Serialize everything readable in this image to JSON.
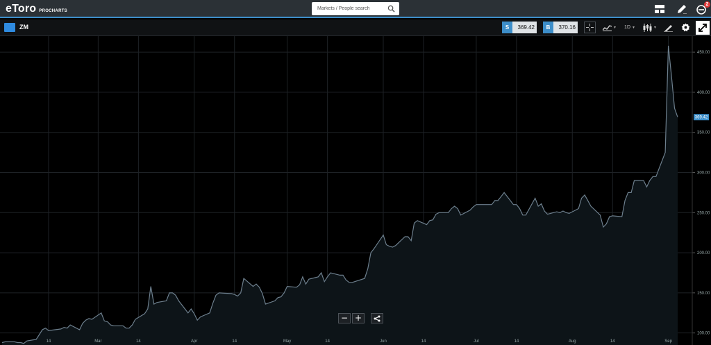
{
  "header": {
    "logo_text": "eToro",
    "logo_sub": "PROCHARTS",
    "search_placeholder": "Markets / People search",
    "notification_count": "2"
  },
  "toolbar": {
    "symbol": "ZM",
    "sell_label": "S",
    "sell_price": "369.42",
    "buy_label": "B",
    "buy_price": "370.16",
    "timeframe": "1D"
  },
  "colors": {
    "accent": "#3d8ec9",
    "line": "#6d7f8d",
    "area_fill": "#0d1418",
    "grid": "#1e2226"
  },
  "icons": [
    "search-icon",
    "layout-icon",
    "pencil-icon",
    "notification-icon",
    "crosshair-icon",
    "indicators-icon",
    "candlestick-icon",
    "draw-tools-icon",
    "gear-icon",
    "expand-icon",
    "share-icon"
  ],
  "chart_data": {
    "type": "area",
    "current_price_label": "369.42",
    "ylim": [
      85,
      470
    ],
    "y_ticks": [
      100,
      150,
      200,
      250,
      300,
      350,
      400,
      450
    ],
    "y_tick_labels": [
      "100.00",
      "150.00",
      "200.00",
      "250.00",
      "300.00",
      "350.00",
      "400.00",
      "450.00"
    ],
    "x_ticks": [
      {
        "date": "2020-02-14",
        "label": "14"
      },
      {
        "date": "2020-03-01",
        "label": "Mar"
      },
      {
        "date": "2020-03-14",
        "label": "14"
      },
      {
        "date": "2020-04-01",
        "label": "Apr"
      },
      {
        "date": "2020-04-14",
        "label": "14"
      },
      {
        "date": "2020-05-01",
        "label": "May"
      },
      {
        "date": "2020-05-14",
        "label": "14"
      },
      {
        "date": "2020-06-01",
        "label": "Jun"
      },
      {
        "date": "2020-06-14",
        "label": "14"
      },
      {
        "date": "2020-07-01",
        "label": "Jul"
      },
      {
        "date": "2020-07-14",
        "label": "14"
      },
      {
        "date": "2020-08-01",
        "label": "Aug"
      },
      {
        "date": "2020-08-14",
        "label": "14"
      },
      {
        "date": "2020-09-01",
        "label": "Sep"
      }
    ],
    "series": [
      {
        "x": [
          "2020-01-30",
          "2020-01-31",
          "2020-02-03",
          "2020-02-04",
          "2020-02-05",
          "2020-02-06",
          "2020-02-07",
          "2020-02-10",
          "2020-02-11",
          "2020-02-12",
          "2020-02-13",
          "2020-02-14",
          "2020-02-18",
          "2020-02-19",
          "2020-02-20",
          "2020-02-21",
          "2020-02-24",
          "2020-02-25",
          "2020-02-26",
          "2020-02-27",
          "2020-02-28",
          "2020-03-02",
          "2020-03-03",
          "2020-03-04",
          "2020-03-05",
          "2020-03-06",
          "2020-03-09",
          "2020-03-10",
          "2020-03-11",
          "2020-03-12",
          "2020-03-13",
          "2020-03-16",
          "2020-03-17",
          "2020-03-18",
          "2020-03-19",
          "2020-03-20",
          "2020-03-23",
          "2020-03-24",
          "2020-03-25",
          "2020-03-26",
          "2020-03-27",
          "2020-03-30",
          "2020-03-31",
          "2020-04-01",
          "2020-04-02",
          "2020-04-03",
          "2020-04-06",
          "2020-04-07",
          "2020-04-08",
          "2020-04-09",
          "2020-04-13",
          "2020-04-14",
          "2020-04-15",
          "2020-04-16",
          "2020-04-17",
          "2020-04-20",
          "2020-04-21",
          "2020-04-22",
          "2020-04-23",
          "2020-04-24",
          "2020-04-27",
          "2020-04-28",
          "2020-04-29",
          "2020-04-30",
          "2020-05-01",
          "2020-05-04",
          "2020-05-05",
          "2020-05-06",
          "2020-05-07",
          "2020-05-08",
          "2020-05-11",
          "2020-05-12",
          "2020-05-13",
          "2020-05-14",
          "2020-05-15",
          "2020-05-18",
          "2020-05-19",
          "2020-05-20",
          "2020-05-21",
          "2020-05-22",
          "2020-05-26",
          "2020-05-27",
          "2020-05-28",
          "2020-05-29",
          "2020-06-01",
          "2020-06-02",
          "2020-06-03",
          "2020-06-04",
          "2020-06-05",
          "2020-06-08",
          "2020-06-09",
          "2020-06-10",
          "2020-06-11",
          "2020-06-12",
          "2020-06-15",
          "2020-06-16",
          "2020-06-17",
          "2020-06-18",
          "2020-06-19",
          "2020-06-22",
          "2020-06-23",
          "2020-06-24",
          "2020-06-25",
          "2020-06-26",
          "2020-06-29",
          "2020-06-30",
          "2020-07-01",
          "2020-07-02",
          "2020-07-06",
          "2020-07-07",
          "2020-07-08",
          "2020-07-09",
          "2020-07-10",
          "2020-07-13",
          "2020-07-14",
          "2020-07-15",
          "2020-07-16",
          "2020-07-17",
          "2020-07-20",
          "2020-07-21",
          "2020-07-22",
          "2020-07-23",
          "2020-07-24",
          "2020-07-27",
          "2020-07-28",
          "2020-07-29",
          "2020-07-30",
          "2020-07-31",
          "2020-08-03",
          "2020-08-04",
          "2020-08-05",
          "2020-08-06",
          "2020-08-07",
          "2020-08-10",
          "2020-08-11",
          "2020-08-12",
          "2020-08-13",
          "2020-08-14",
          "2020-08-17",
          "2020-08-18",
          "2020-08-19",
          "2020-08-20",
          "2020-08-21",
          "2020-08-24",
          "2020-08-25",
          "2020-08-26",
          "2020-08-27",
          "2020-08-28",
          "2020-08-31",
          "2020-09-01",
          "2020-09-02",
          "2020-09-03",
          "2020-09-04"
        ],
        "y": [
          88,
          89,
          89,
          88,
          88,
          87,
          90,
          92,
          98,
          104,
          106,
          103,
          105,
          107,
          106,
          110,
          104,
          112,
          116,
          118,
          117,
          125,
          115,
          114,
          110,
          109,
          109,
          106,
          106,
          110,
          117,
          124,
          130,
          158,
          136,
          138,
          140,
          150,
          150,
          147,
          140,
          125,
          130,
          124,
          116,
          120,
          125,
          137,
          147,
          150,
          149,
          148,
          146,
          150,
          168,
          158,
          161,
          157,
          149,
          136,
          140,
          144,
          145,
          150,
          158,
          157,
          160,
          170,
          161,
          167,
          170,
          175,
          164,
          170,
          175,
          172,
          172,
          166,
          163,
          163,
          168,
          180,
          200,
          205,
          222,
          210,
          208,
          207,
          209,
          220,
          220,
          215,
          237,
          240,
          235,
          240,
          241,
          248,
          250,
          250,
          255,
          258,
          255,
          247,
          253,
          257,
          260,
          260,
          260,
          265,
          265,
          270,
          275,
          260,
          260,
          255,
          247,
          247,
          268,
          258,
          261,
          252,
          248,
          251,
          250,
          252,
          250,
          249,
          255,
          268,
          272,
          265,
          258,
          247,
          232,
          236,
          245,
          246,
          245,
          265,
          275,
          275,
          290,
          290,
          282,
          290,
          295,
          295,
          325,
          458,
          420,
          380,
          369
        ]
      }
    ]
  }
}
